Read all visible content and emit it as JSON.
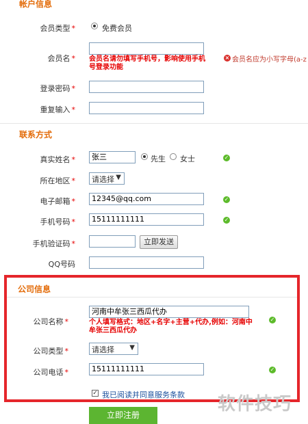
{
  "account": {
    "title": "帐户信息",
    "member_type_label": "会员类型",
    "member_type_option": "免费会员",
    "member_name_label": "会员名",
    "member_name_hint": "会员名请勿填写手机号，影响使用手机号登录功能",
    "member_name_error": "会员名应为小写字母(a-z",
    "password_label": "登录密码",
    "repeat_label": "重复输入"
  },
  "contact": {
    "title": "联系方式",
    "realname_label": "真实姓名",
    "realname_value": "张三",
    "gender_male": "先生",
    "gender_female": "女士",
    "region_label": "所在地区",
    "region_value": "请选择",
    "email_label": "电子邮箱",
    "email_value": "12345@qq.com",
    "mobile_label": "手机号码",
    "mobile_value": "15111111111",
    "verify_label": "手机验证码",
    "verify_button": "立即发送",
    "qq_label": "QQ号码"
  },
  "company": {
    "title": "公司信息",
    "name_label": "公司名称",
    "name_value": "河南中牟张三西瓜代办",
    "name_hint": "个人填写格式：地区+名字+主营+代办,例如：河南中牟张三西瓜代办",
    "type_label": "公司类型",
    "type_value": "请选择",
    "phone_label": "公司电话",
    "phone_value": "15111111111"
  },
  "agreement": {
    "label": "我已阅读并同意服务条款",
    "checked": true
  },
  "submit_label": "立即注册",
  "required_mark": "*",
  "watermark": "软件技巧",
  "colors": {
    "section_title": "#e36c0a",
    "required": "#e60000",
    "highlight_frame": "#e5262b",
    "submit": "#5cb531",
    "ok": "#5dbb2b"
  },
  "icons": {
    "ok": "check-circle-icon",
    "error": "error-circle-icon"
  }
}
